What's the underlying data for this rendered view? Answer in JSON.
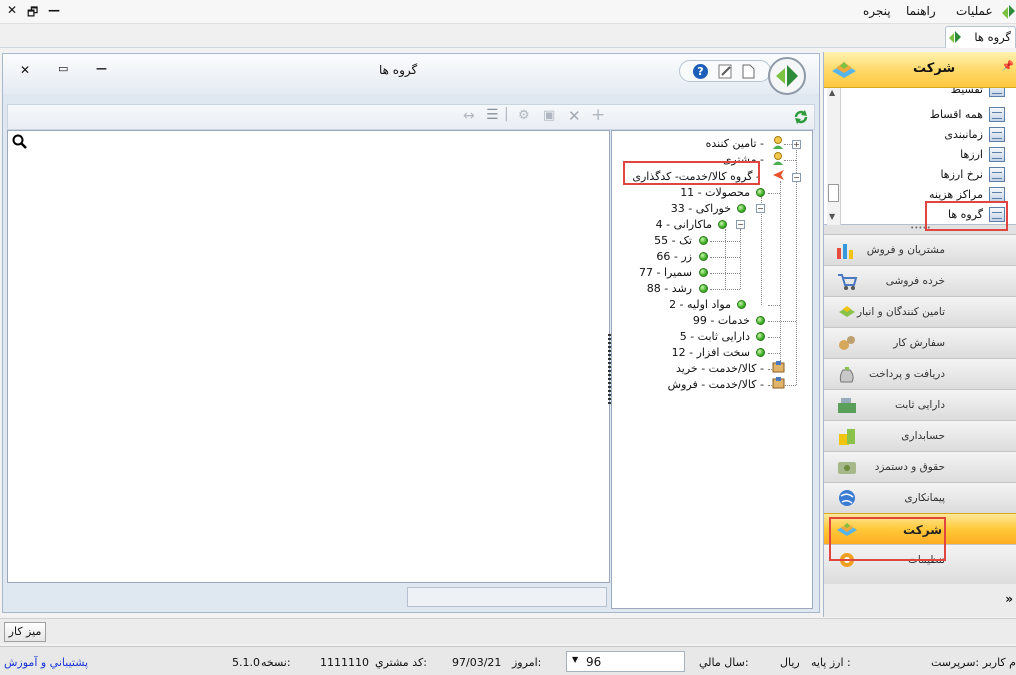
{
  "menu": {
    "items": [
      "عملیات",
      "راهنما",
      "پنجره"
    ],
    "window_controls": {
      "close": "✕",
      "restore": "🗗",
      "minimize": "—"
    }
  },
  "tab": {
    "label": "گروه ها"
  },
  "window": {
    "title": "گروه ها",
    "controls": {
      "close": "✕",
      "restore": "▭",
      "minimize": "—"
    },
    "help": "?"
  },
  "tree": {
    "nodes": [
      {
        "label": "تامین کننده",
        "code": ""
      },
      {
        "label": "مشتری",
        "code": ""
      },
      {
        "label": "گروه کالا/خدمت- کدگذاری",
        "code": ""
      },
      {
        "label": "محصولات",
        "code": "11"
      },
      {
        "label": "خوراکی",
        "code": "33"
      },
      {
        "label": "ماکارانی",
        "code": "4"
      },
      {
        "label": "تک",
        "code": "55"
      },
      {
        "label": "زر",
        "code": "66"
      },
      {
        "label": "سمیرا",
        "code": "77"
      },
      {
        "label": "رشد",
        "code": "88"
      },
      {
        "label": "مواد اولیه",
        "code": "2"
      },
      {
        "label": "خدمات",
        "code": "99"
      },
      {
        "label": "دارایی ثابت",
        "code": "5"
      },
      {
        "label": "سخت افزار",
        "code": "12"
      },
      {
        "label": "کالا/خدمت - خرید",
        "code": ""
      },
      {
        "label": "کالا/خدمت - فروش",
        "code": ""
      }
    ]
  },
  "nav": {
    "header_title": "شرکت",
    "pin": "📌",
    "list": [
      "تقسیط",
      "همه اقساط",
      "زمانبندی",
      "ارزها",
      "نرخ ارزها",
      "مراکز هزینه",
      "گروه ها"
    ],
    "sections": [
      "مشتریان و فروش",
      "خرده فروشی",
      "تامین کنندگان و انبار",
      "سفارش کار",
      "دریافت و پرداخت",
      "دارایی ثابت",
      "حسابداری",
      "حقوق و دستمزد",
      "پیمانکاری",
      "شرکت",
      "تنظیمات"
    ],
    "more": "»"
  },
  "taskbar": {
    "desk": "میز کار"
  },
  "status": {
    "user": "م کاربر :سرپرست",
    "currency_label": "ارز پایه :",
    "currency": "ريال",
    "fiscal_label": "سال مالي:",
    "fiscal_year": "96",
    "today_label": "امروز:",
    "today": "97/03/21",
    "customer_code_label": "کد مشتري:",
    "customer_code": "1111110",
    "version_label": "نسخه:",
    "version": "5.1.0",
    "support": "پشتيباني و آموزش"
  },
  "colors": {
    "highlight": "#e0463f",
    "active_section": "#ffc93a",
    "link": "#1a35d6"
  }
}
